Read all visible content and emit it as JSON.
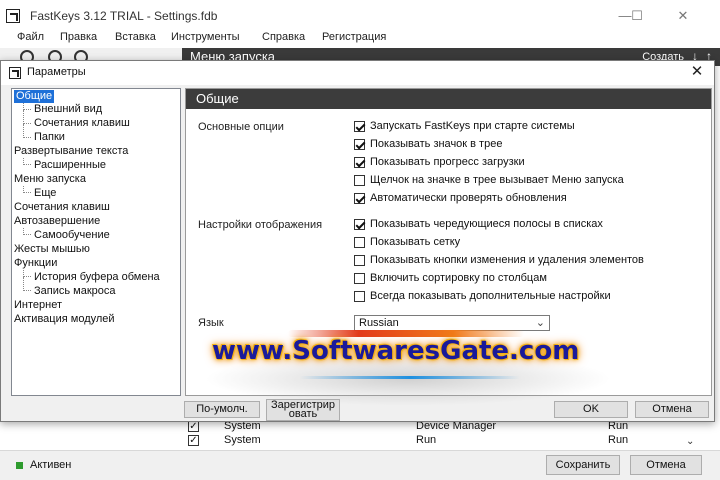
{
  "main_window": {
    "title": "FastKeys 3.12 TRIAL - Settings.fdb",
    "controls": {
      "minimize": "—",
      "maximize": "☐",
      "close": "✕"
    }
  },
  "menu": [
    "Файл",
    "Правка",
    "Вставка",
    "Инструменты",
    "Справка",
    "Регистрация"
  ],
  "launch_header": {
    "title": "Меню запуска",
    "create": "Создать",
    "arrow_down": "↓",
    "arrow_up": "↑"
  },
  "launch_rows": [
    {
      "checked": true,
      "col1": "System",
      "col2": "Device Manager",
      "col3": "Run"
    },
    {
      "checked": true,
      "col1": "System",
      "col2": "Run",
      "col3": "Run"
    }
  ],
  "status": {
    "text": "Активен",
    "save_label": "Сохранить",
    "cancel_label": "Отмена"
  },
  "dialog": {
    "title": "Параметры",
    "panel_title": "Общие",
    "tree": [
      {
        "label": "Общие",
        "level": 0,
        "selected": true
      },
      {
        "label": "Внешний вид",
        "level": 1
      },
      {
        "label": "Сочетания клавиш",
        "level": 1
      },
      {
        "label": "Папки",
        "level": 1
      },
      {
        "label": "Развертывание текста",
        "level": 0
      },
      {
        "label": "Расширенные",
        "level": 1
      },
      {
        "label": "Меню запуска",
        "level": 0
      },
      {
        "label": "Еще",
        "level": 1
      },
      {
        "label": "Сочетания клавиш",
        "level": 0
      },
      {
        "label": "Автозавершение",
        "level": 0
      },
      {
        "label": "Самообучение",
        "level": 1
      },
      {
        "label": "Жесты мышью",
        "level": 0
      },
      {
        "label": "Функции",
        "level": 0
      },
      {
        "label": "История буфера обмена",
        "level": 1
      },
      {
        "label": "Запись макроса",
        "level": 1
      },
      {
        "label": "Интернет",
        "level": 0
      },
      {
        "label": "Активация модулей",
        "level": 0
      }
    ],
    "groups": {
      "basic_label": "Основные опции",
      "basic": [
        {
          "label": "Запускать FastKeys при старте системы",
          "checked": true
        },
        {
          "label": "Показывать значок в трее",
          "checked": true
        },
        {
          "label": "Показывать прогресс загрузки",
          "checked": true
        },
        {
          "label": "Щелчок на значке в трее вызывает Меню запуска",
          "checked": false
        },
        {
          "label": "Автоматически проверять обновления",
          "checked": true
        }
      ],
      "display_label": "Настройки отображения",
      "display": [
        {
          "label": "Показывать чередующиеся полосы в списках",
          "checked": true
        },
        {
          "label": "Показывать сетку",
          "checked": false
        },
        {
          "label": "Показывать кнопки изменения и удаления элементов",
          "checked": false
        },
        {
          "label": "Включить сортировку по столбцам",
          "checked": false
        },
        {
          "label": "Всегда показывать дополнительные настройки",
          "checked": false
        }
      ]
    },
    "language": {
      "label": "Язык",
      "value": "Russian"
    },
    "buttons": {
      "default": "По-умолч.",
      "register_line1": "Зарегистрир",
      "register_line2": "овать",
      "ok": "OK",
      "cancel": "Отмена"
    }
  },
  "watermark": "www.SoftwaresGate.com",
  "colors": {
    "selection": "#1e70d8",
    "header_dark": "#3c3c3c",
    "status_active": "#2e9b2e"
  }
}
